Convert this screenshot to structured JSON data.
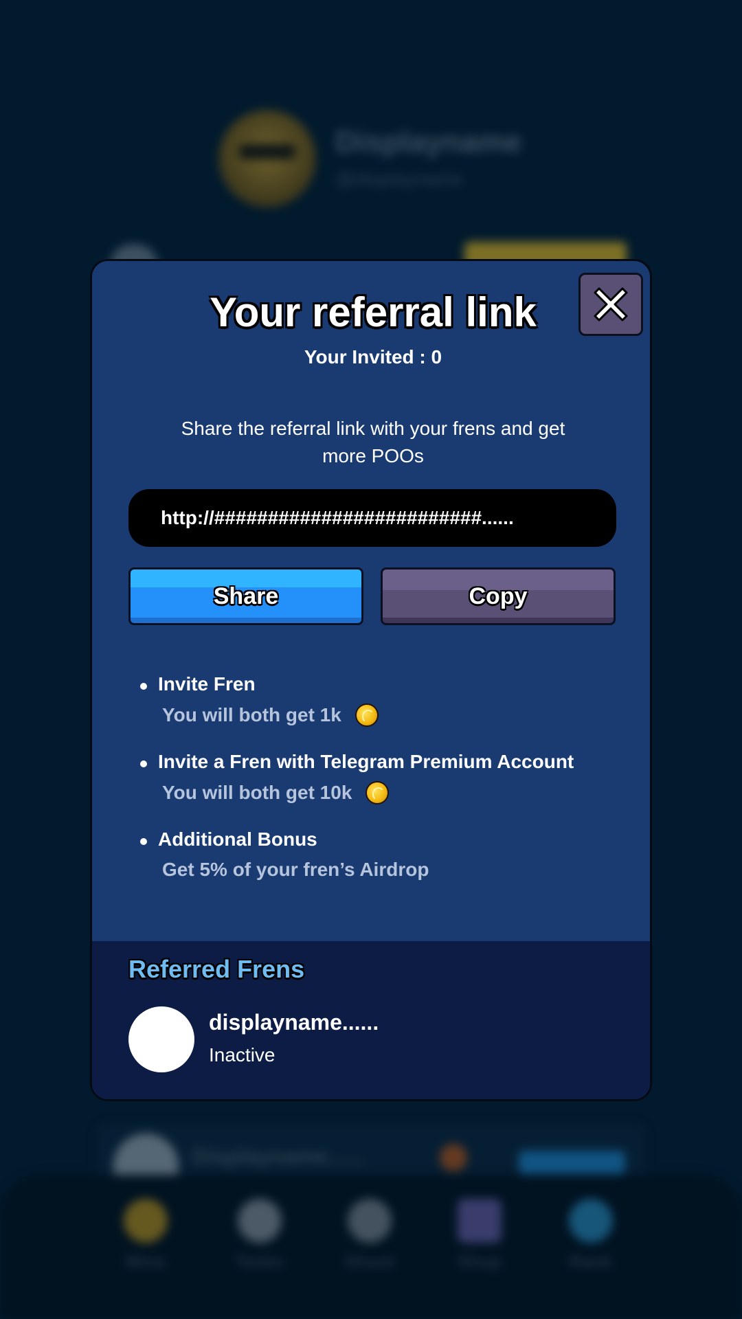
{
  "background": {
    "profile_name": "Displayname",
    "profile_handle": "@displayname",
    "row_name": "Displayname......",
    "nav": [
      "Mine",
      "Tasks",
      "Shoot",
      "Shop",
      "Rank"
    ]
  },
  "modal": {
    "title": "Your referral link",
    "invited_text": "Your Invited : 0",
    "description": "Share the referral link with your frens and get more POOs",
    "link": "http://#########################......",
    "share_label": "Share",
    "copy_label": "Copy",
    "perks": [
      {
        "title": "Invite Fren",
        "desc": "You will both get 1k",
        "coin": true
      },
      {
        "title": "Invite a Fren with Telegram Premium Account",
        "desc": "You will both get 10k",
        "coin": true
      },
      {
        "title": "Additional Bonus",
        "desc": "Get 5% of your fren’s Airdrop",
        "coin": false
      }
    ],
    "referred": {
      "title": "Referred Frens",
      "frens": [
        {
          "name": "displayname......",
          "status": "Inactive"
        }
      ]
    }
  },
  "colors": {
    "modal_bg": "#1a3b72",
    "referred_bg": "#0c1c45",
    "share_button": "#2490fa",
    "copy_button": "#5a4f75",
    "referred_title": "#6fbcf2"
  }
}
